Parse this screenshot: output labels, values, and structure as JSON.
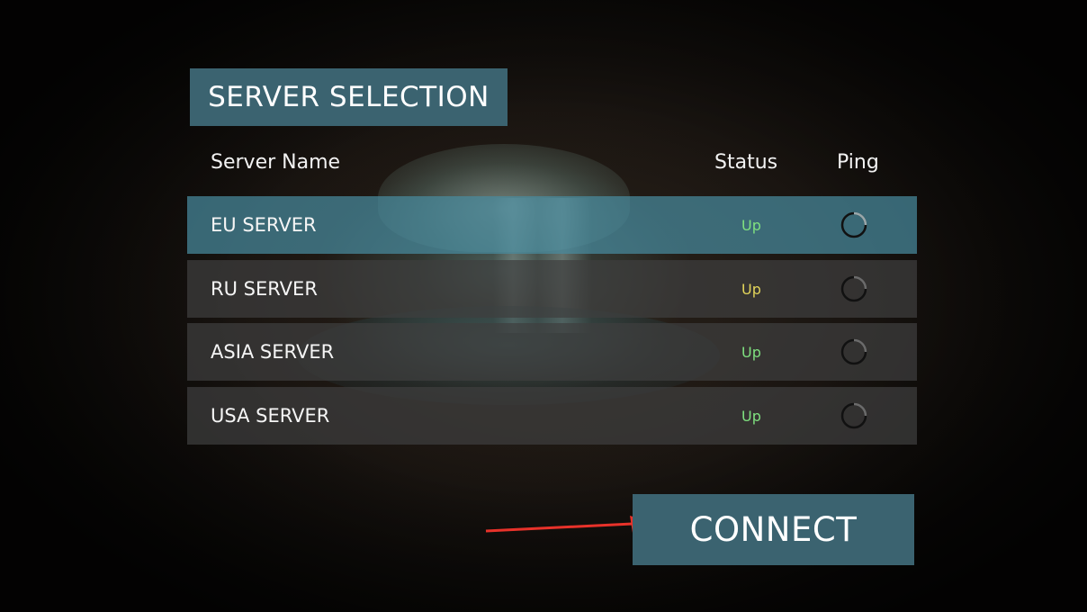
{
  "title": "SERVER SELECTION",
  "columns": {
    "name": "Server Name",
    "status": "Status",
    "ping": "Ping"
  },
  "servers": [
    {
      "name": "EU SERVER",
      "status": "Up",
      "status_color": "#7fe07f",
      "ping_icon": "loading-ring-icon",
      "selected": true
    },
    {
      "name": "RU SERVER",
      "status": "Up",
      "status_color": "#e2d45a",
      "ping_icon": "loading-ring-icon",
      "selected": false
    },
    {
      "name": "ASIA SERVER",
      "status": "Up",
      "status_color": "#7fe07f",
      "ping_icon": "loading-ring-icon",
      "selected": false
    },
    {
      "name": "USA SERVER",
      "status": "Up",
      "status_color": "#7fe07f",
      "ping_icon": "loading-ring-icon",
      "selected": false
    }
  ],
  "connect_label": "CONNECT",
  "colors": {
    "panel_accent": "#3b6370",
    "selected_row": "#488a9e",
    "row_bg": "#3e3e3e",
    "annotation_arrow": "#e8322a"
  }
}
